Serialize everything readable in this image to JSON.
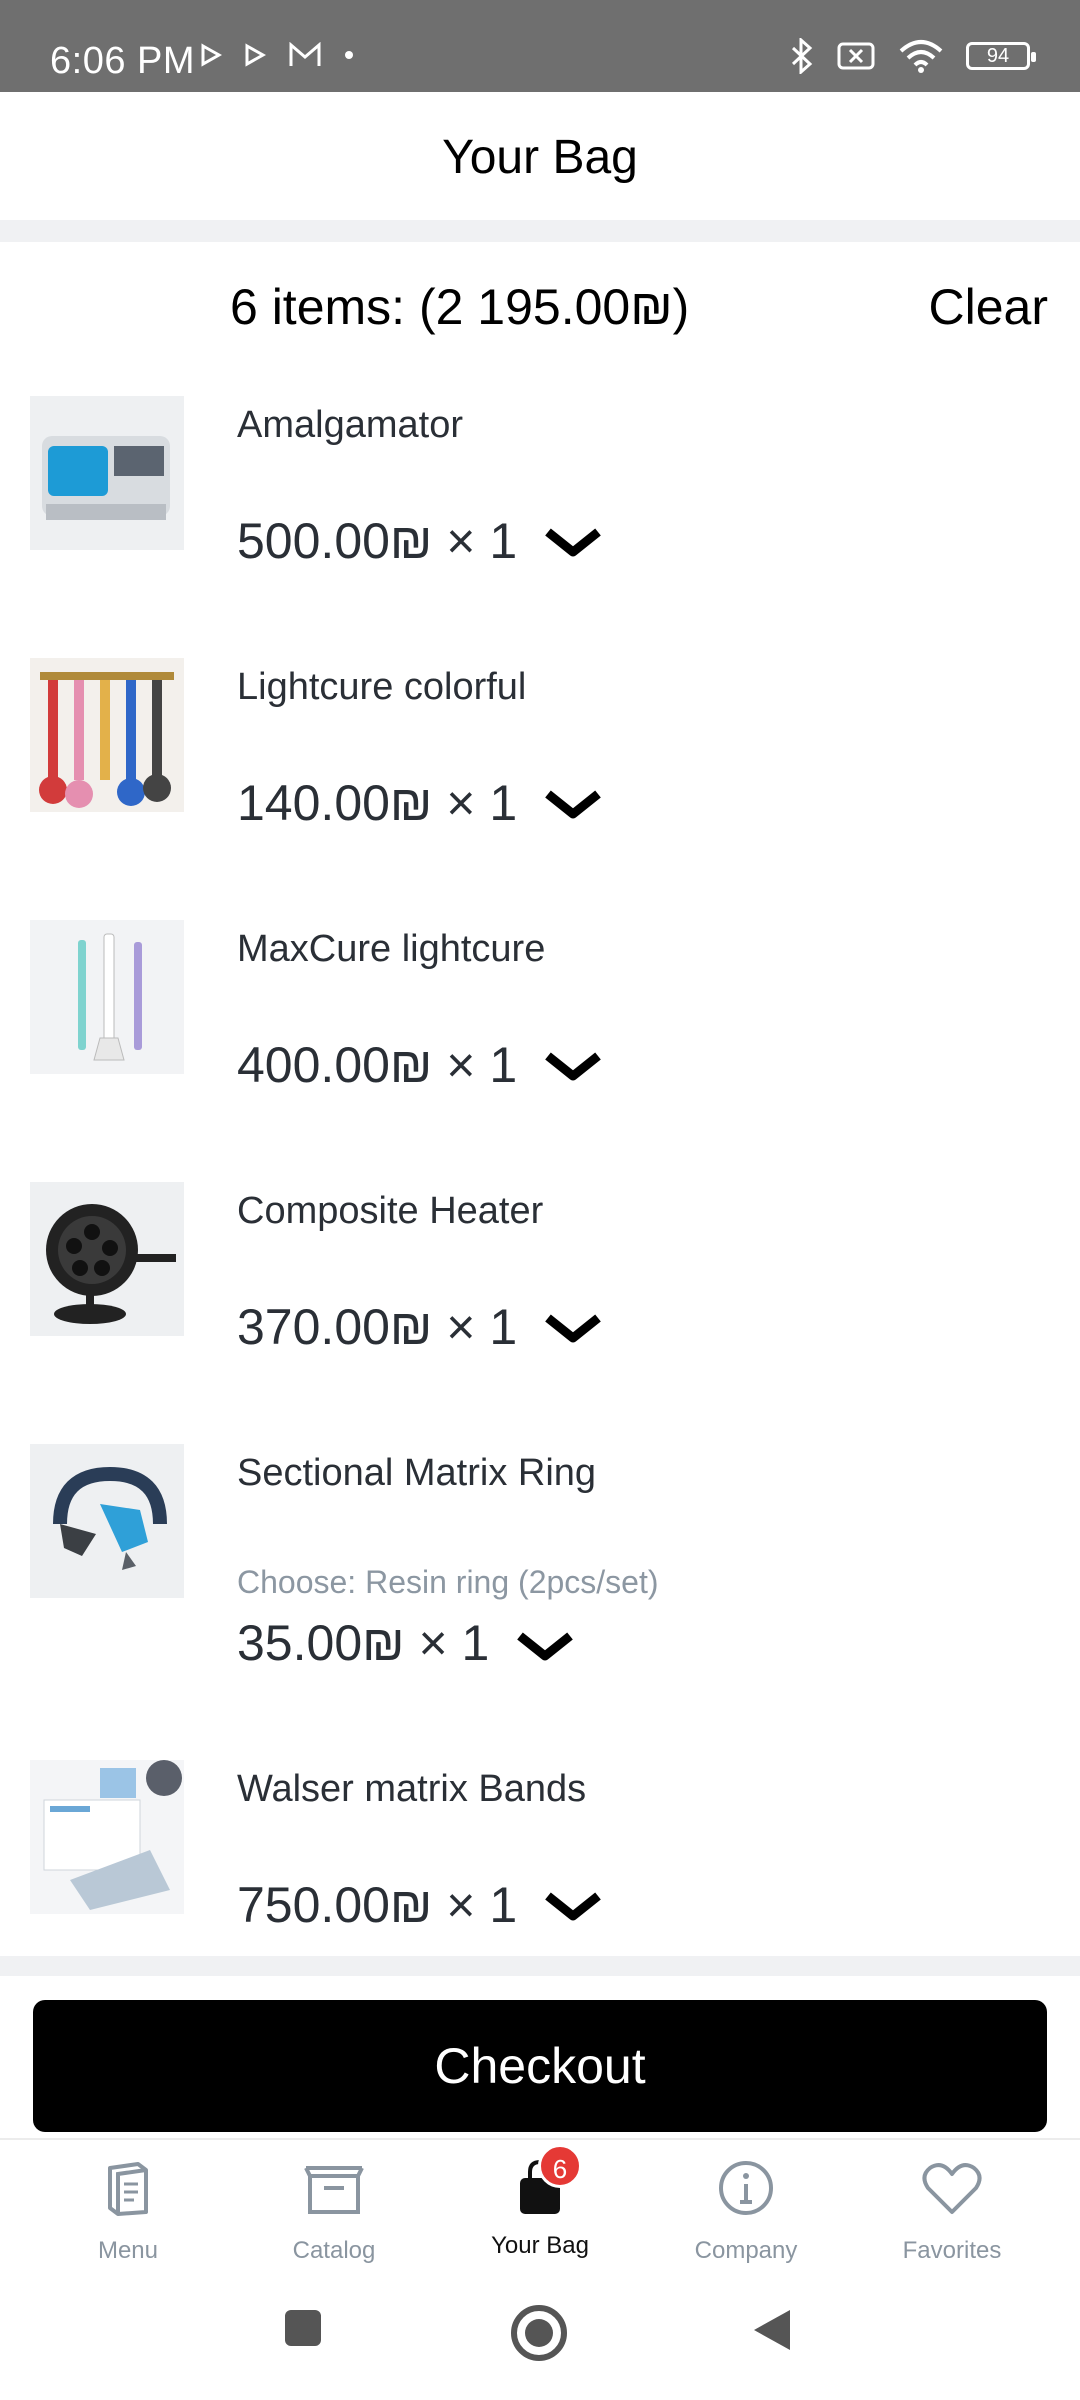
{
  "status_bar": {
    "time": "6:06 PM",
    "battery": "94",
    "left_icons": [
      "play-icon",
      "play-icon",
      "gmail-icon",
      "dot-icon"
    ],
    "right_icons": [
      "bluetooth-icon",
      "no-sim-icon",
      "wifi-icon",
      "battery-icon"
    ]
  },
  "header": {
    "title": "Your Bag"
  },
  "summary": {
    "text": "6 items: (2 195.00₪)",
    "clear_label": "Clear"
  },
  "items": [
    {
      "name": "Amalgamator",
      "option": "",
      "price": "500.00₪ × 1"
    },
    {
      "name": "Lightcure colorful",
      "option": "",
      "price": "140.00₪ × 1"
    },
    {
      "name": "MaxCure lightcure",
      "option": "",
      "price": "400.00₪ × 1"
    },
    {
      "name": "Composite Heater",
      "option": "",
      "price": "370.00₪ × 1"
    },
    {
      "name": "Sectional Matrix Ring",
      "option": "Choose: Resin ring (2pcs/set)",
      "price": "35.00₪ × 1"
    },
    {
      "name": "Walser matrix Bands",
      "option": "",
      "price": "750.00₪ × 1"
    }
  ],
  "checkout_label": "Checkout",
  "nav": {
    "items": [
      {
        "label": "Menu",
        "icon": "menu-book-icon"
      },
      {
        "label": "Catalog",
        "icon": "catalog-icon"
      },
      {
        "label": "Your Bag",
        "icon": "bag-icon",
        "badge": "6"
      },
      {
        "label": "Company",
        "icon": "info-icon"
      },
      {
        "label": "Favorites",
        "icon": "heart-icon"
      }
    ]
  },
  "colors": {
    "accent": "#000000",
    "badge": "#e53935",
    "muted_text": "#8a95a0",
    "band": "#f0f1f3"
  }
}
